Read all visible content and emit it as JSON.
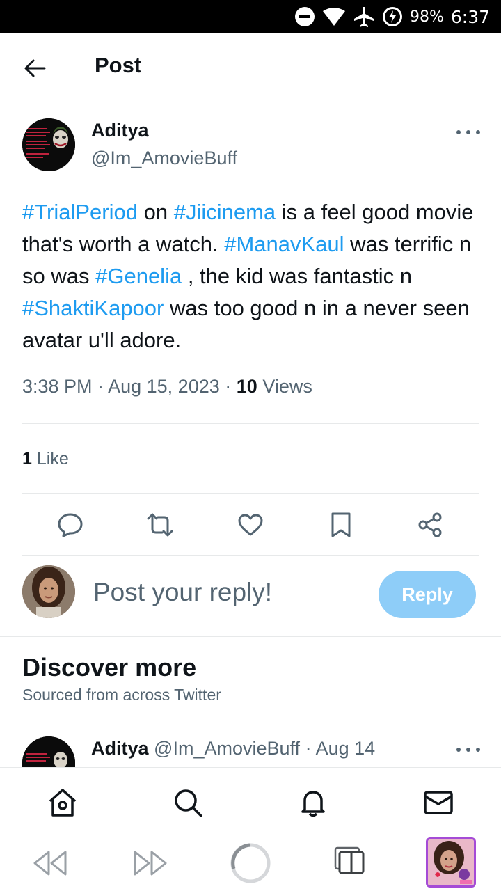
{
  "status_bar": {
    "battery": "98%",
    "time": "6:37",
    "icons": [
      "dnd-icon",
      "wifi-icon",
      "airplane-icon",
      "battery-saver-icon"
    ]
  },
  "header": {
    "title": "Post",
    "back_icon": "arrow-left-icon"
  },
  "tweet": {
    "author_name": "Aditya",
    "author_handle": "@Im_AmovieBuff",
    "text_segments": [
      {
        "t": "#TrialPeriod",
        "tag": true
      },
      {
        "t": " on ",
        "tag": false
      },
      {
        "t": "#Jiicinema",
        "tag": true
      },
      {
        "t": " is a feel good movie that's worth a watch. ",
        "tag": false
      },
      {
        "t": "#ManavKaul",
        "tag": true
      },
      {
        "t": " was terrific n so was ",
        "tag": false
      },
      {
        "t": "#Genelia",
        "tag": true
      },
      {
        "t": " , the kid was fantastic n ",
        "tag": false
      },
      {
        "t": "#ShaktiKapoor",
        "tag": true
      },
      {
        "t": " was too good n in a never seen avatar u'll adore.",
        "tag": false
      }
    ],
    "time": "3:38 PM",
    "date": "Aug 15, 2023",
    "views_count": "10",
    "views_label": "Views",
    "likes_count": "1",
    "likes_label": "Like"
  },
  "actions": [
    "reply-icon",
    "retweet-icon",
    "like-icon",
    "bookmark-icon",
    "share-icon"
  ],
  "reply_box": {
    "placeholder": "Post your reply!",
    "button_label": "Reply"
  },
  "discover": {
    "title": "Discover more",
    "subtitle": "Sourced from across Twitter",
    "next_tweet": {
      "name": "Aditya",
      "handle": "@Im_AmovieBuff",
      "separator": "·",
      "date": "Aug 14"
    }
  },
  "bottom_nav": [
    "home-icon",
    "search-icon",
    "notifications-icon",
    "messages-icon"
  ],
  "browser_bar": [
    "back-icon",
    "forward-icon",
    "loading-icon",
    "tabs-icon",
    "profile-thumbnail"
  ],
  "colors": {
    "accent": "#1d9bf0",
    "reply_button": "#8ecdf8",
    "secondary_text": "#536471",
    "profile_border": "#a54bd6"
  }
}
